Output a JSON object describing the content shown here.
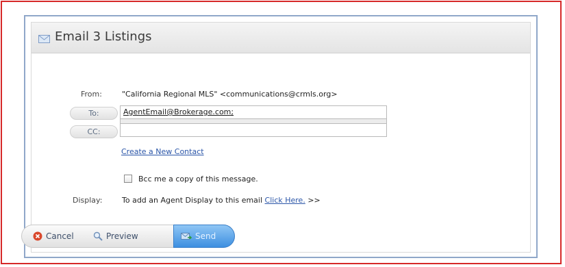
{
  "dialog": {
    "title": "Email 3 Listings"
  },
  "from": {
    "label": "From:",
    "value": "\"California Regional MLS\" <communications@crmls.org>"
  },
  "to": {
    "button_label": "To:",
    "value": "AgentEmail@Brokerage.com;"
  },
  "cc": {
    "button_label": "CC:",
    "value": ""
  },
  "create_contact_link": "Create a New Contact",
  "bcc_checkbox": {
    "label": "Bcc me a copy of this message.",
    "checked": false
  },
  "display": {
    "label": "Display:",
    "text": "To add an Agent Display to this email",
    "link": "Click Here.",
    "suffix": ">>"
  },
  "buttons": {
    "cancel": "Cancel",
    "preview": "Preview",
    "send": "Send"
  },
  "icons": {
    "header": "envelope-icon",
    "cancel": "cancel-icon",
    "preview": "magnifier-icon",
    "send": "send-icon"
  },
  "colors": {
    "frame_border": "#d62828",
    "dialog_border": "#8fa7c9",
    "link": "#2a55a8",
    "send_button": "#3d8fe0",
    "cancel_icon": "#d9472b"
  }
}
